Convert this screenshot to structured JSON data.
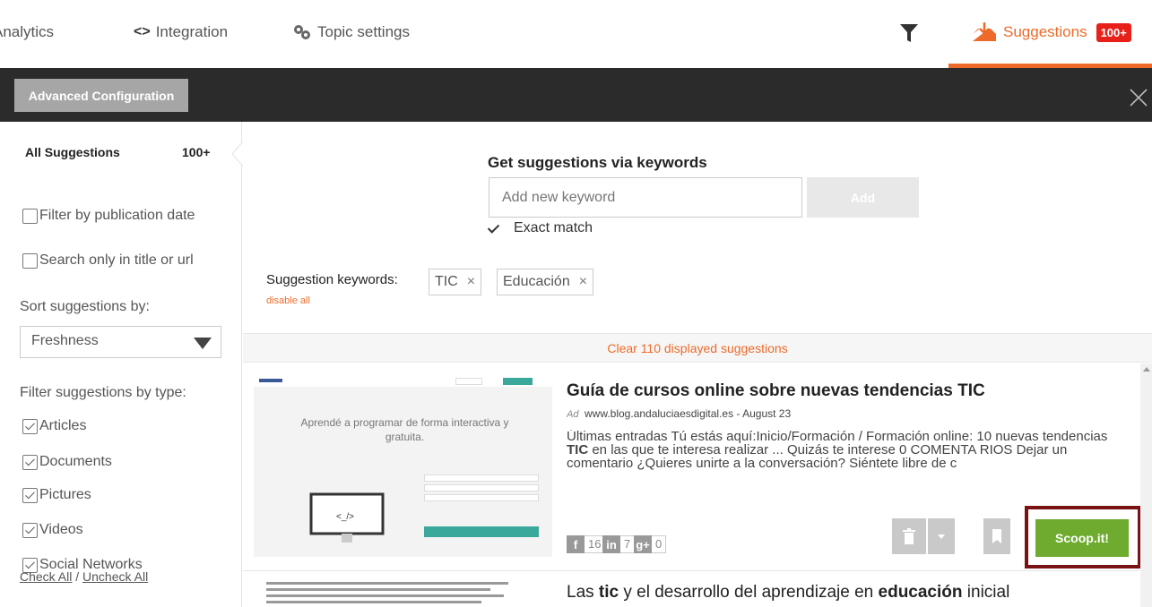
{
  "nav": {
    "analytics": "Analytics",
    "integration": "Integration",
    "topic_settings": "Topic settings",
    "suggestions": "Suggestions",
    "suggestions_badge": "100+"
  },
  "toolbar": {
    "advanced_configuration": "Advanced Configuration"
  },
  "sidebar": {
    "all_suggestions": "All Suggestions",
    "all_count": "100+",
    "filter_by_date": "Filter by publication date",
    "search_title_url": "Search only in title or url",
    "sort_label": "Sort suggestions by:",
    "sort_value": "Freshness",
    "filter_type_label": "Filter suggestions by type:",
    "types": [
      "Articles",
      "Documents",
      "Pictures",
      "Videos",
      "Social Networks"
    ],
    "check_all": "Check All",
    "slash": "/",
    "uncheck_all": "Uncheck All"
  },
  "keywords": {
    "title": "Get suggestions via keywords",
    "placeholder": "Add new keyword",
    "add_label": "Add",
    "exact_match": "Exact match",
    "suggestion_keywords_label": "Suggestion keywords:",
    "disable_all": "disable all",
    "tags": [
      "TIC",
      "Educación"
    ]
  },
  "clear_bar": "Clear 110 displayed suggestions",
  "card1": {
    "title_pre": "Guía de cursos online sobre nuevas tendencias ",
    "title_bold": "TIC",
    "source": "www.blog.andaluciaesdigital.es - August 23",
    "snippet_pre": "Últimas entradas Tú estás aquí:Inicio/Formación / Formación online: 10 nuevas tendencias ",
    "snippet_bold": "TIC",
    "snippet_post": " en las que te interesa realizar ... Quizás te interese 0 COMENTA RIOS Dejar un comentario ¿Quieres unirte a la conversación? Siéntete libre de c",
    "thumb_headline": "Aprendé a programar de forma interactiva y gratuita.",
    "facebook": "16",
    "linkedin": "7",
    "gplus": "0",
    "scoop_label": "Scoop.it!"
  },
  "card2": {
    "t1": "Las ",
    "t2": "tic",
    "t3": " y el desarrollo del aprendizaje en ",
    "t4": "educación",
    "t5": " inicial"
  },
  "colors": {
    "accent": "#ee6a2a",
    "scoop_green": "#6eab2e",
    "badge_red": "#e8201a"
  }
}
